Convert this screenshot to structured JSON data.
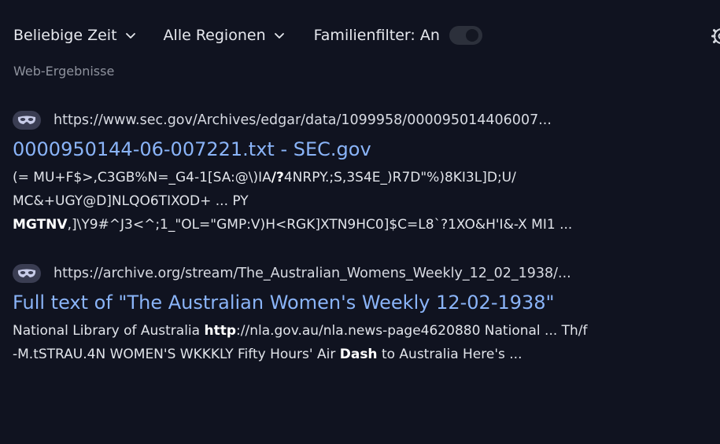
{
  "filters": {
    "time_label": "Beliebige Zeit",
    "region_label": "Alle Regionen",
    "family_filter_label": "Familienfilter: An",
    "family_filter_state": "on"
  },
  "icons": {
    "chevron": "chevron-down-icon",
    "settings": "gear-icon",
    "favicon": "mask-icon"
  },
  "colors": {
    "background": "#101320",
    "link": "#8ab4f8",
    "muted": "#8e929d"
  },
  "section_label": "Web-Ergebnisse",
  "results": [
    {
      "url": "https://www.sec.gov/Archives/edgar/data/1099958/000095014406007...",
      "title": "0000950144-06-007221.txt - SEC.gov",
      "snippet": {
        "l1_a": "(= MU+F$>,C3GB%N=_G4-1[SA:@\\)IA",
        "l1_b": "/?",
        "l1_c": "4NRPY.;S,3S4E_)R7D\"%)8KI3L]D;U/",
        "l2": "MC&+UGY@D]NLQO6TIXOD+ ... PY",
        "l3_a": "MGTNV",
        "l3_b": ",]\\Y9#^J3<^;1_\"OL=\"GMP:V)H<RGK]XTN9HC0]$C=L8`?1XO&H'I&-X MI1 ..."
      }
    },
    {
      "url": "https://archive.org/stream/The_Australian_Womens_Weekly_12_02_1938/...",
      "title": "Full text of \"The Australian Women's Weekly 12-02-1938\"",
      "snippet": {
        "l1_a": "National Library of Australia ",
        "l1_b": "http",
        "l1_c": "://nla.gov.au/nla.news-page4620880 National ... Th/f",
        "l2_a": "-M.tSTRAU.4N WOMEN'S WKKKLY Fifty Hours' Air ",
        "l2_b": "Dash",
        "l2_c": " to Australia Here's ..."
      }
    }
  ]
}
